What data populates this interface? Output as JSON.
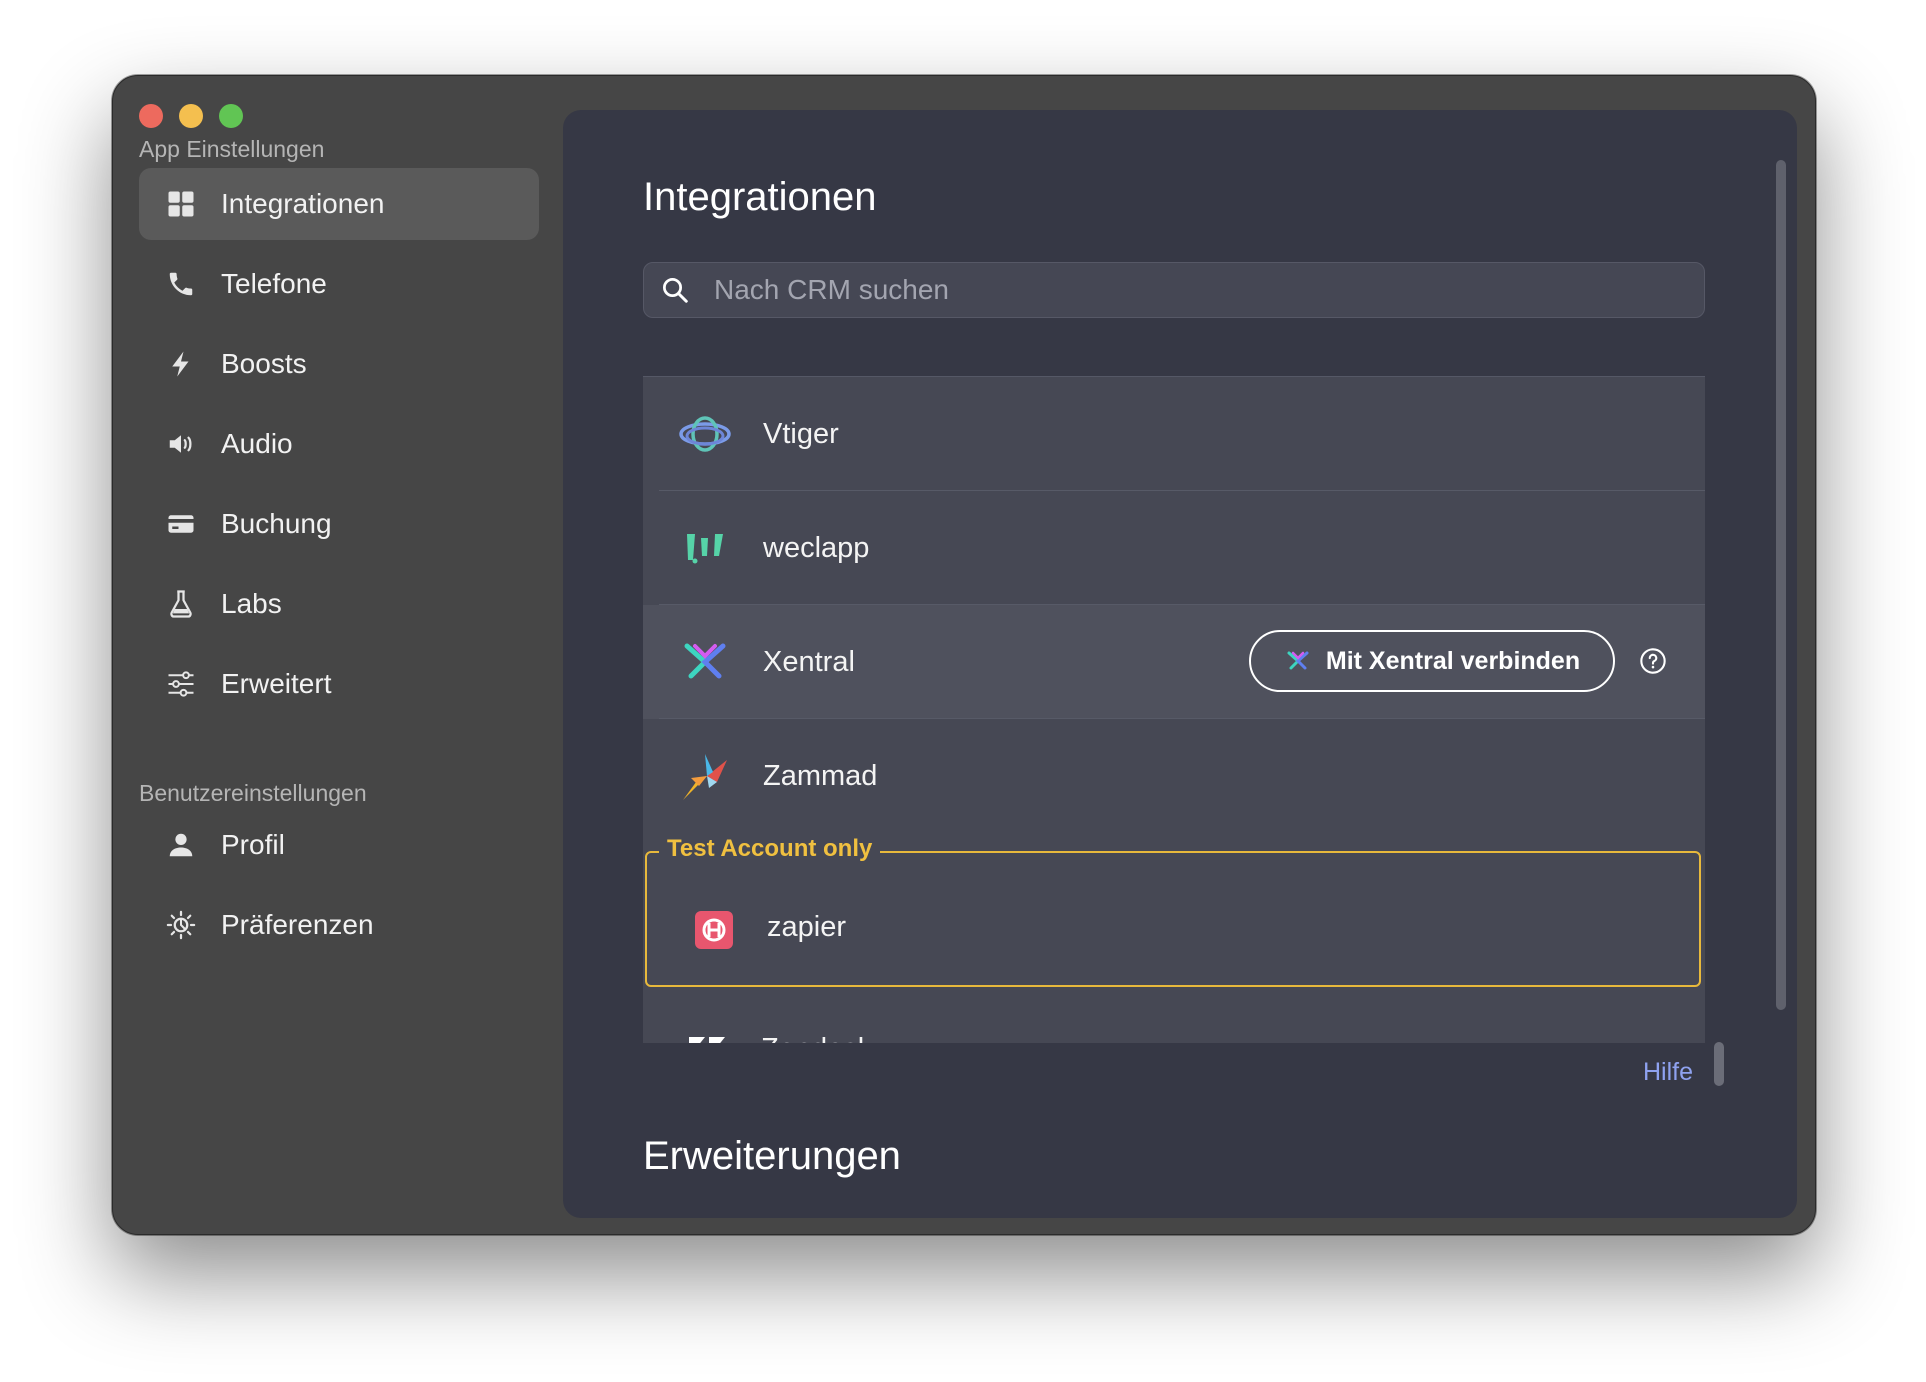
{
  "sidebar": {
    "section_app": "App Einstellungen",
    "section_user": "Benutzereinstellungen",
    "items": [
      {
        "label": "Integrationen",
        "icon": "grid-icon"
      },
      {
        "label": "Telefone",
        "icon": "phone-icon"
      },
      {
        "label": "Boosts",
        "icon": "bolt-icon"
      },
      {
        "label": "Audio",
        "icon": "speaker-icon"
      },
      {
        "label": "Buchung",
        "icon": "card-icon"
      },
      {
        "label": "Labs",
        "icon": "flask-icon"
      },
      {
        "label": "Erweitert",
        "icon": "sliders-icon"
      }
    ],
    "user_items": [
      {
        "label": "Profil",
        "icon": "person-icon"
      },
      {
        "label": "Präferenzen",
        "icon": "sun-gear-icon"
      }
    ],
    "active": "Integrationen"
  },
  "main": {
    "title": "Integrationen",
    "search_placeholder": "Nach CRM suchen",
    "integrations": [
      {
        "name": "Vtiger",
        "icon": "vtiger-logo-icon"
      },
      {
        "name": "weclapp",
        "icon": "weclapp-logo-icon"
      },
      {
        "name": "Xentral",
        "icon": "xentral-logo-icon",
        "connect_label": "Mit Xentral verbinden"
      },
      {
        "name": "Zammad",
        "icon": "zammad-logo-icon"
      }
    ],
    "test_section": {
      "legend": "Test Account only",
      "item": {
        "name": "zapier",
        "icon": "zapier-logo-icon"
      }
    },
    "partial_item": {
      "name": "Zendesk",
      "icon": "zendesk-logo-icon"
    },
    "help_label": "Hilfe",
    "extensions_title": "Erweiterungen"
  },
  "colors": {
    "sidebar_bg": "#464646",
    "main_bg": "#363845",
    "accent_link": "#8fa2f0",
    "test_border": "#e8b93c"
  }
}
